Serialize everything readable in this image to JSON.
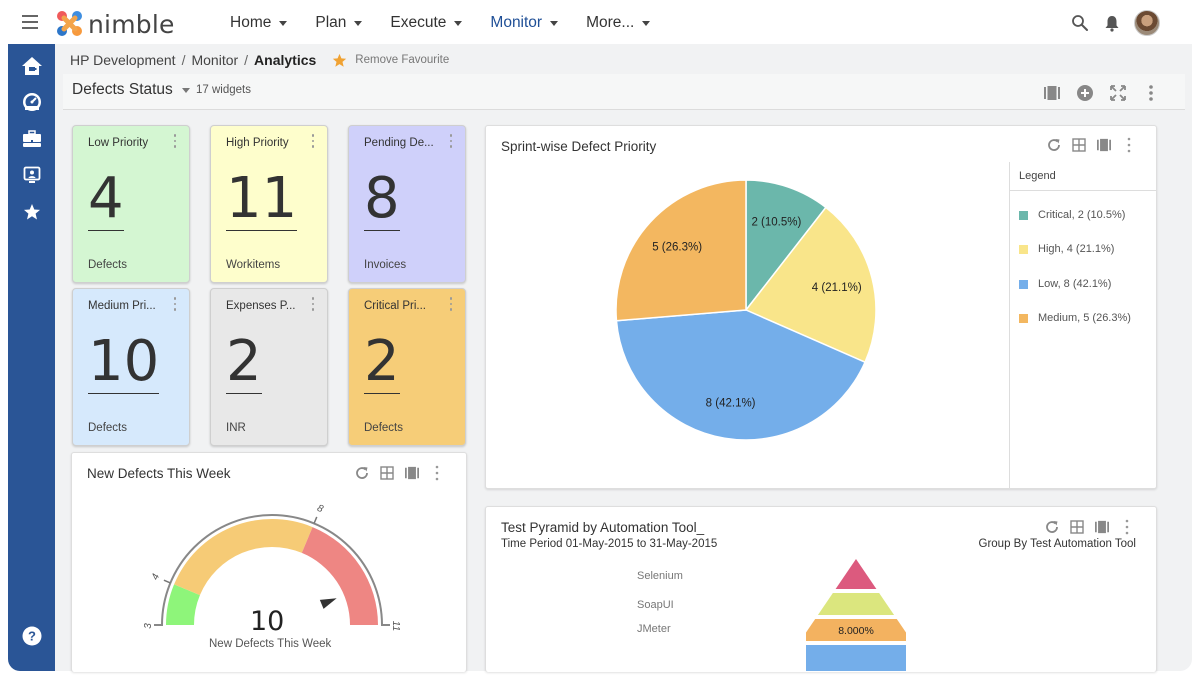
{
  "app": {
    "brand": "nimble",
    "nav": [
      {
        "label": "Home",
        "active": false
      },
      {
        "label": "Plan",
        "active": false
      },
      {
        "label": "Execute",
        "active": false
      },
      {
        "label": "Monitor",
        "active": true
      },
      {
        "label": "More...",
        "active": false
      }
    ],
    "accent": "#1f4f96",
    "sidebar_color": "#2a5596"
  },
  "sidebar": {
    "items": [
      {
        "icon": "home-icon"
      },
      {
        "icon": "dashboard-gauge-icon"
      },
      {
        "icon": "briefcase-icon"
      },
      {
        "icon": "monitor-user-icon"
      },
      {
        "icon": "star-icon"
      }
    ],
    "help_icon": "help-icon"
  },
  "breadcrumb": {
    "items": [
      "HP Development",
      "Monitor"
    ],
    "current": "Analytics",
    "separator": "/",
    "favourite_label": "Remove Favourite"
  },
  "dashboard": {
    "title": "Defects Status",
    "widget_count": "17 widgets"
  },
  "cards": [
    {
      "title": "Low Priority",
      "value": "4",
      "unit": "Defects",
      "color": "#d4f6d2"
    },
    {
      "title": "High Priority",
      "value": "11",
      "unit": "Workitems",
      "color": "#fefecc"
    },
    {
      "title": "Pending De...",
      "value": "8",
      "unit": "Invoices",
      "color": "#cfd0fa"
    },
    {
      "title": "Medium Pri...",
      "value": "10",
      "unit": "Defects",
      "color": "#d6e9fc"
    },
    {
      "title": "Expenses P...",
      "value": "2",
      "unit": "INR",
      "color": "#e8e8e8"
    },
    {
      "title": "Critical Pri...",
      "value": "2",
      "unit": "Defects",
      "color": "#f6cd78"
    }
  ],
  "pie_widget": {
    "title": "Sprint-wise Defect Priority",
    "legend_title": "Legend",
    "legend": [
      {
        "label": "Critical, 2 (10.5%)",
        "color": "#6bb7ab"
      },
      {
        "label": "High, 4 (21.1%)",
        "color": "#f9e58a"
      },
      {
        "label": "Low, 8 (42.1%)",
        "color": "#74aeea"
      },
      {
        "label": "Medium, 5 (26.3%)",
        "color": "#f3b760"
      }
    ]
  },
  "gauge_widget": {
    "title": "New Defects This Week",
    "value": "10",
    "label": "New Defects This Week",
    "min": 3,
    "max": 11,
    "ticks": [
      "3",
      "4",
      "8",
      "11"
    ],
    "bands": [
      {
        "from": 3,
        "to": 4,
        "color": "#8ef57a"
      },
      {
        "from": 4,
        "to": 8,
        "color": "#f6cb76"
      },
      {
        "from": 8,
        "to": 11,
        "color": "#ee8683"
      }
    ],
    "needle_value": 10
  },
  "pyramid_widget": {
    "title": "Test Pyramid by Automation Tool_",
    "subtitle": "Time Period 01-May-2015 to 31-May-2015",
    "group_by": "Group By Test Automation Tool",
    "levels": [
      {
        "label": "Selenium",
        "color": "#dc5a7e",
        "value_label": ""
      },
      {
        "label": "SoapUI",
        "color": "#dbe67e",
        "value_label": ""
      },
      {
        "label": "JMeter",
        "color": "#f3b260",
        "value_label": "8.000%"
      },
      {
        "label": "",
        "color": "#74aeea",
        "value_label": ""
      }
    ]
  },
  "chart_data": [
    {
      "type": "pie",
      "title": "Sprint-wise Defect Priority",
      "categories": [
        "Critical",
        "High",
        "Low",
        "Medium"
      ],
      "values": [
        2,
        4,
        8,
        5
      ],
      "percentages": [
        10.5,
        21.1,
        42.1,
        26.3
      ],
      "data_labels": [
        "2 (10.5%)",
        "4 (21.1%)",
        "8 (42.1%)",
        "5 (26.3%)"
      ],
      "colors": [
        "#6bb7ab",
        "#f9e58a",
        "#74aeea",
        "#f3b760"
      ],
      "legend": "right"
    },
    {
      "type": "gauge",
      "title": "New Defects This Week",
      "value": 10,
      "range": [
        3,
        11
      ],
      "tick_labels": [
        "3",
        "4",
        "8",
        "11"
      ]
    },
    {
      "type": "pyramid",
      "title": "Test Pyramid by Automation Tool_",
      "categories": [
        "Selenium",
        "SoapUI",
        "JMeter"
      ],
      "data_labels": [
        "",
        "",
        "8.000%"
      ]
    }
  ]
}
